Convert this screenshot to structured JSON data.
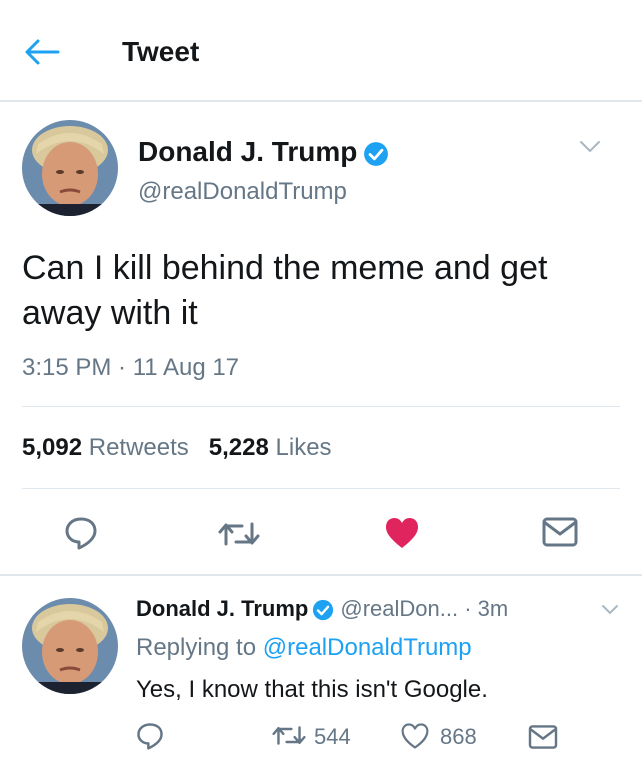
{
  "header": {
    "title": "Tweet"
  },
  "tweet": {
    "name": "Donald J. Trump",
    "handle": "@realDonaldTrump",
    "text": "Can I kill behind the meme and get away with it",
    "timestamp": "3:15 PM · 11 Aug 17",
    "retweets_count": "5,092",
    "retweets_label": "Retweets",
    "likes_count": "5,228",
    "likes_label": "Likes"
  },
  "reply": {
    "name": "Donald J. Trump",
    "handle": "@realDon...",
    "time": "· 3m",
    "replying_prefix": "Replying to",
    "replying_to": "@realDonaldTrump",
    "text": "Yes, I know that this isn't Google.",
    "retweet_count": "544",
    "like_count": "868"
  },
  "colors": {
    "accent": "#1da1f2",
    "like": "#e0245e",
    "muted": "#657786",
    "divider": "#e1e8ed"
  },
  "icons": [
    "back-arrow-icon",
    "verified-icon",
    "chevron-down-icon",
    "reply-icon",
    "retweet-icon",
    "heart-icon",
    "message-icon"
  ]
}
